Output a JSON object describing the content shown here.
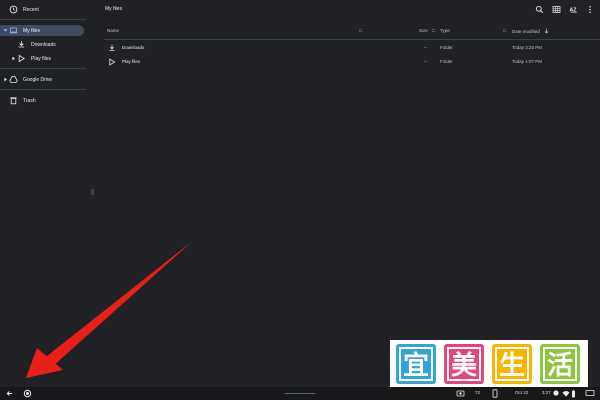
{
  "sidebar": {
    "items": [
      {
        "label": "Recent",
        "icon": "clock-icon"
      },
      {
        "label": "My files",
        "icon": "laptop-icon",
        "selected": true
      },
      {
        "label": "Downloads",
        "icon": "download-icon"
      },
      {
        "label": "Play files",
        "icon": "play-icon"
      },
      {
        "label": "Google Drive",
        "icon": "drive-icon"
      },
      {
        "label": "Trash",
        "icon": "trash-icon"
      }
    ]
  },
  "header": {
    "title": "My files",
    "sort_label": "AZ"
  },
  "table": {
    "columns": {
      "name": "Name",
      "size": "Size",
      "type": "Type",
      "date": "Date modified"
    },
    "rows": [
      {
        "name": "Downloads",
        "size": "--",
        "type": "Folder",
        "date": "Today 3:25 PM",
        "icon": "download-icon"
      },
      {
        "name": "Play files",
        "size": "--",
        "type": "Folder",
        "date": "Today 1:07 PM",
        "icon": "play-icon"
      }
    ]
  },
  "shelf": {
    "badge": "72",
    "date": "Oct 22",
    "time": "3:27"
  },
  "colors": {
    "background": "#202124",
    "selected": "#414a5e",
    "arrow": "#e8201a"
  },
  "watermark": {
    "text": "宜美生活"
  }
}
